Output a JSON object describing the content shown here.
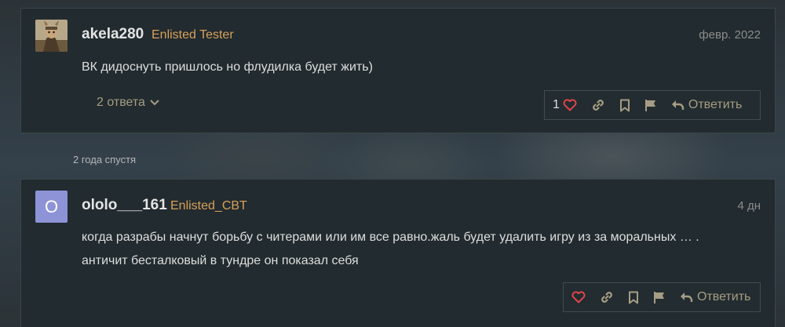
{
  "posts": [
    {
      "username": "akela280",
      "user_title": "Enlisted Tester",
      "date": "февр. 2022",
      "avatar": {
        "type": "image",
        "icon": "soldier-avatar-icon"
      },
      "text_lines": [
        "ВК дидоснуть пришлось но флудилка будет жить)"
      ],
      "replies_label": "2 ответа",
      "like_count": "1",
      "reply_label": "Ответить"
    },
    {
      "username": "ololo___161",
      "user_title": "Enlisted_CBT",
      "date": "4 дн",
      "avatar": {
        "type": "letter",
        "letter": "O",
        "color": "#8d93d6"
      },
      "text_lines": [
        "когда разрабы начнут борьбу с читерами или им все равно.жаль будет удалить игру из за моральных … .",
        "античит бесталковый в тундре он показал себя"
      ],
      "like_count": "",
      "reply_label": "Ответить"
    }
  ],
  "time_gap": "2 года спустя",
  "colors": {
    "accent": "#d8a05a",
    "heart": "#e0454a",
    "action_icon": "#a59d84"
  }
}
